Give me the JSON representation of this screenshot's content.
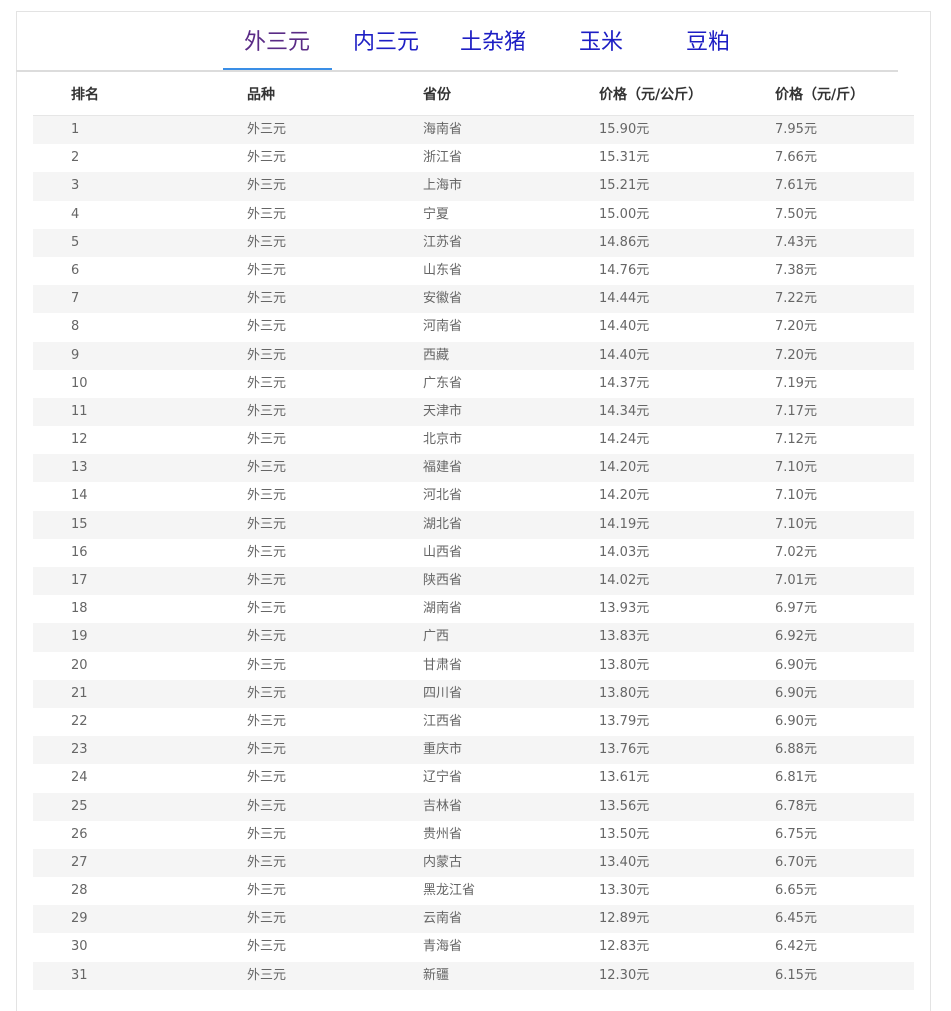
{
  "tabs": [
    {
      "label": "外三元",
      "active": true
    },
    {
      "label": "内三元",
      "active": false
    },
    {
      "label": "土杂猪",
      "active": false
    },
    {
      "label": "玉米",
      "active": false
    },
    {
      "label": "豆粕",
      "active": false
    }
  ],
  "table": {
    "headers": [
      "排名",
      "品种",
      "省份",
      "价格（元/公斤）",
      "价格（元/斤）"
    ],
    "rows": [
      [
        "1",
        "外三元",
        "海南省",
        "15.90元",
        "7.95元"
      ],
      [
        "2",
        "外三元",
        "浙江省",
        "15.31元",
        "7.66元"
      ],
      [
        "3",
        "外三元",
        "上海市",
        "15.21元",
        "7.61元"
      ],
      [
        "4",
        "外三元",
        "宁夏",
        "15.00元",
        "7.50元"
      ],
      [
        "5",
        "外三元",
        "江苏省",
        "14.86元",
        "7.43元"
      ],
      [
        "6",
        "外三元",
        "山东省",
        "14.76元",
        "7.38元"
      ],
      [
        "7",
        "外三元",
        "安徽省",
        "14.44元",
        "7.22元"
      ],
      [
        "8",
        "外三元",
        "河南省",
        "14.40元",
        "7.20元"
      ],
      [
        "9",
        "外三元",
        "西藏",
        "14.40元",
        "7.20元"
      ],
      [
        "10",
        "外三元",
        "广东省",
        "14.37元",
        "7.19元"
      ],
      [
        "11",
        "外三元",
        "天津市",
        "14.34元",
        "7.17元"
      ],
      [
        "12",
        "外三元",
        "北京市",
        "14.24元",
        "7.12元"
      ],
      [
        "13",
        "外三元",
        "福建省",
        "14.20元",
        "7.10元"
      ],
      [
        "14",
        "外三元",
        "河北省",
        "14.20元",
        "7.10元"
      ],
      [
        "15",
        "外三元",
        "湖北省",
        "14.19元",
        "7.10元"
      ],
      [
        "16",
        "外三元",
        "山西省",
        "14.03元",
        "7.02元"
      ],
      [
        "17",
        "外三元",
        "陕西省",
        "14.02元",
        "7.01元"
      ],
      [
        "18",
        "外三元",
        "湖南省",
        "13.93元",
        "6.97元"
      ],
      [
        "19",
        "外三元",
        "广西",
        "13.83元",
        "6.92元"
      ],
      [
        "20",
        "外三元",
        "甘肃省",
        "13.80元",
        "6.90元"
      ],
      [
        "21",
        "外三元",
        "四川省",
        "13.80元",
        "6.90元"
      ],
      [
        "22",
        "外三元",
        "江西省",
        "13.79元",
        "6.90元"
      ],
      [
        "23",
        "外三元",
        "重庆市",
        "13.76元",
        "6.88元"
      ],
      [
        "24",
        "外三元",
        "辽宁省",
        "13.61元",
        "6.81元"
      ],
      [
        "25",
        "外三元",
        "吉林省",
        "13.56元",
        "6.78元"
      ],
      [
        "26",
        "外三元",
        "贵州省",
        "13.50元",
        "6.75元"
      ],
      [
        "27",
        "外三元",
        "内蒙古",
        "13.40元",
        "6.70元"
      ],
      [
        "28",
        "外三元",
        "黑龙江省",
        "13.30元",
        "6.65元"
      ],
      [
        "29",
        "外三元",
        "云南省",
        "12.89元",
        "6.45元"
      ],
      [
        "30",
        "外三元",
        "青海省",
        "12.83元",
        "6.42元"
      ],
      [
        "31",
        "外三元",
        "新疆",
        "12.30元",
        "6.15元"
      ]
    ]
  },
  "colors": {
    "tab_text": "#1d1ec4",
    "tab_active_text": "#5a2b86",
    "tab_active_underline": "#3a8ee6",
    "row_stripe": "#f5f5f5",
    "cell_text": "#666666",
    "header_text": "#333333"
  }
}
